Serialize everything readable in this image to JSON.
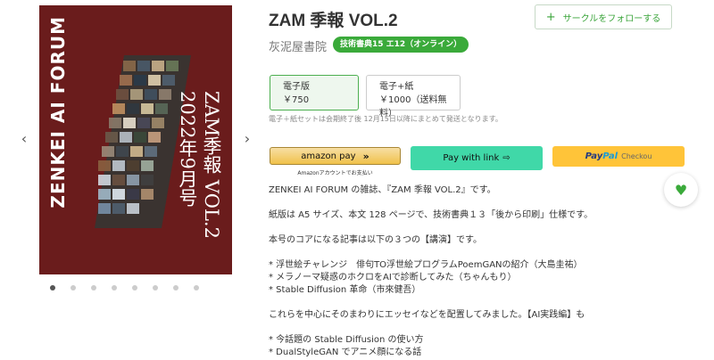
{
  "product": {
    "title": "ZAM 季報 VOL.2",
    "circle": "灰泥屋書院",
    "event_badge": "技術書典15 エ12（オンライン）",
    "follow_label": "サークルをフォローする"
  },
  "cover": {
    "side_title": "ZENKEI AI FORUM",
    "vertical_title": "ZAM季報 VOL.2 2022年9月号",
    "background": "#6a1c1c"
  },
  "carousel": {
    "dot_count": 8,
    "active_index": 0
  },
  "options": [
    {
      "label": "電子版",
      "price": "￥750",
      "selected": true
    },
    {
      "label": "電子+紙",
      "price": "￥1000（送料無料）",
      "selected": false
    }
  ],
  "option_note": "電子＋紙セットは会期終了後 12月15日以降にまとめて発送となります。",
  "payment": {
    "amazon_label": "amazon pay",
    "amazon_sub": "Amazonアカウントでお支払い",
    "link_label": "Pay with link",
    "paypal_label_1": "Pay",
    "paypal_label_2": "Pal",
    "paypal_checkout": "Checkou"
  },
  "description": [
    "ZENKEI AI FORUM の雑誌、『ZAM 季報 VOL.2』です。",
    "",
    "紙版は A5 サイズ、本文 128 ページで、技術書典１３「後から印刷」仕様です。",
    "",
    "本号のコアになる記事は以下の３つの【講演】です。",
    "",
    "* 浮世絵チャレンジ　俳句TO浮世絵プログラムPoemGANの紹介（大島圭祐）",
    "* メラノーマ疑惑のホクロをAIで診断してみた（ちゃんもり）",
    "* Stable Diffusion 革命（市來健吾）",
    "",
    "これらを中心にそのまわりにエッセイなどを配置してみました。【AI実践編】も",
    "",
    "* 今話題の Stable Diffusion の使い方",
    "* DualStyleGAN でアニメ顔になる話"
  ],
  "colors": {
    "accent": "#3aaa3a",
    "link": "#40d8a8",
    "paypal": "#ffc439"
  }
}
